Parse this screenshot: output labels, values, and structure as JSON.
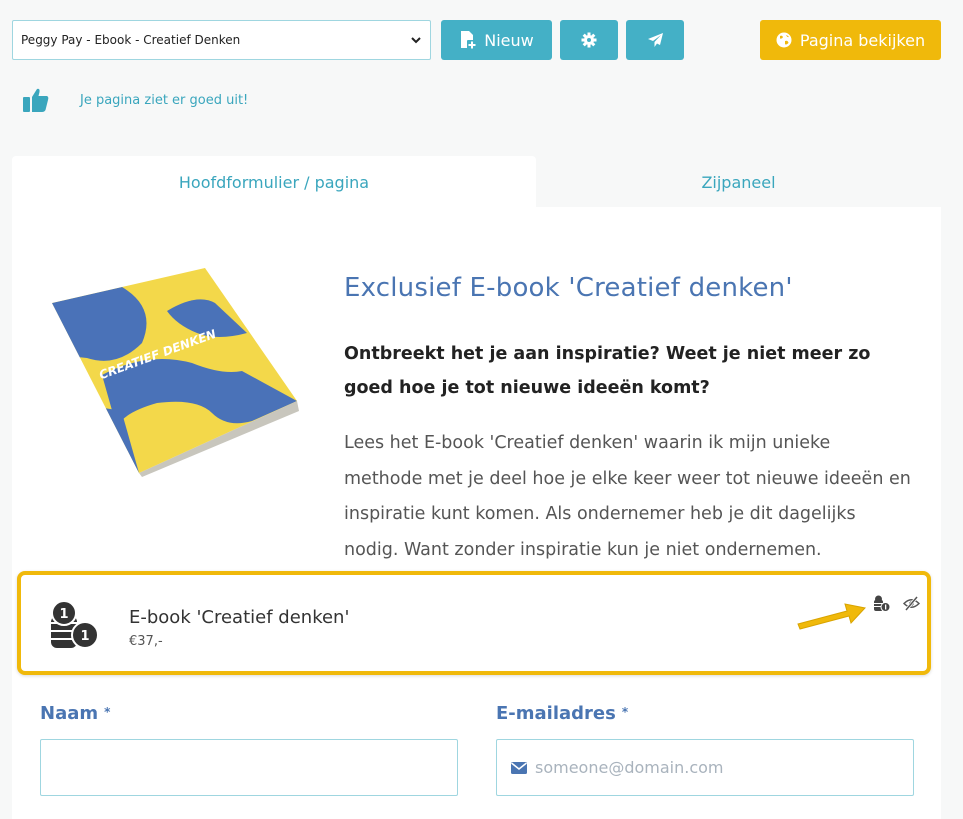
{
  "toolbar": {
    "page_select_value": "Peggy Pay - Ebook - Creatief Denken",
    "new_label": "Nieuw",
    "view_label": "Pagina bekijken"
  },
  "status": {
    "text": "Je pagina ziet er goed uit!"
  },
  "tabs": [
    {
      "label": "Hoofdformulier / pagina",
      "active": true
    },
    {
      "label": "Zijpaneel",
      "active": false
    }
  ],
  "content": {
    "book_cover_text": "CREATIEF DENKEN",
    "headline": "Exclusief E-book 'Creatief denken'",
    "subheadline": "Ontbreekt het je aan inspiratie? Weet je niet meer zo goed hoe je tot nieuwe ideeën komt?",
    "body": "Lees het E-book 'Creatief denken' waarin ik mijn unieke methode met je deel hoe je elke keer weer tot nieuwe ideeën en inspiratie kunt komen. Als ondernemer heb je dit dagelijks nodig. Want zonder inspiratie kun je niet ondernemen."
  },
  "product": {
    "name": "E-book 'Creatief denken'",
    "price": "€37,-",
    "icon": "coins-icon",
    "highlight_color": "#f0b90b"
  },
  "form": {
    "name_label": "Naam",
    "email_label": "E-mailadres",
    "required_marker": "*",
    "email_placeholder": "someone@domain.com"
  },
  "colors": {
    "accent_teal": "#44b0c6",
    "accent_yellow": "#f0b90b",
    "heading_blue": "#4a75b2"
  }
}
